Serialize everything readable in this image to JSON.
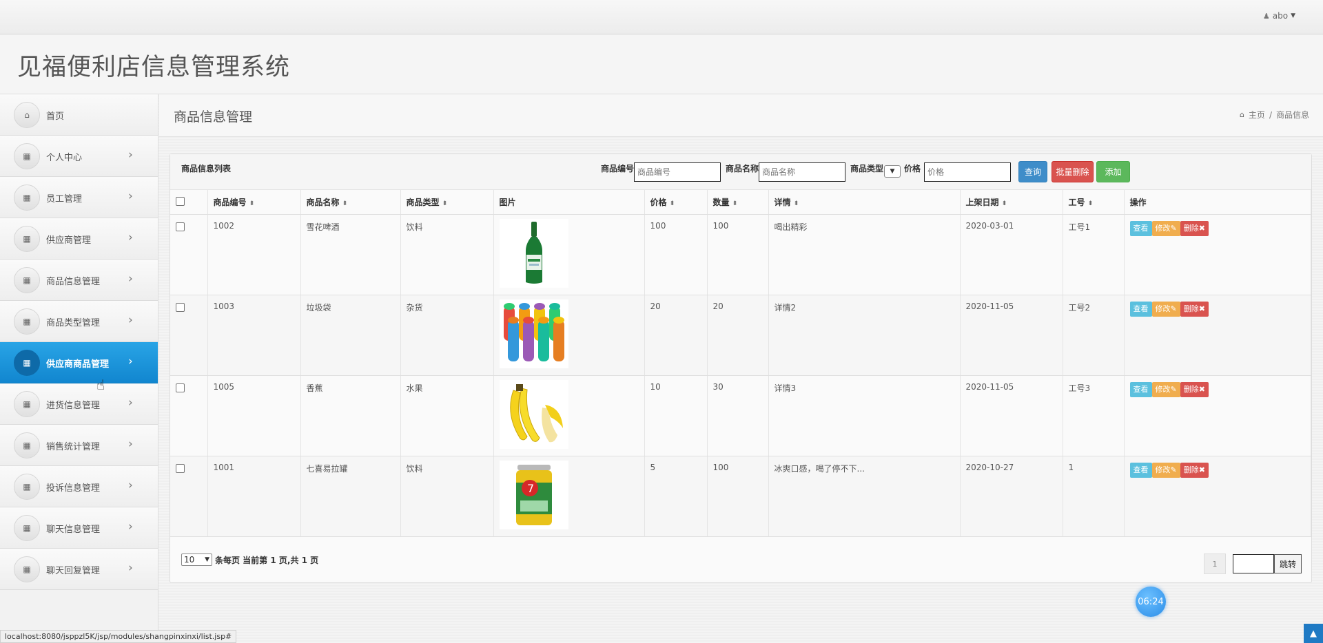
{
  "topbar": {
    "user_name": "abo"
  },
  "header": {
    "app_title": "见福便利店信息管理系统"
  },
  "sidebar": {
    "items": [
      {
        "label": "首页",
        "icon": "home-icon",
        "chevron": false,
        "active": false
      },
      {
        "label": "个人中心",
        "icon": "grid-icon",
        "chevron": true,
        "active": false
      },
      {
        "label": "员工管理",
        "icon": "grid-icon",
        "chevron": true,
        "active": false
      },
      {
        "label": "供应商管理",
        "icon": "grid-icon",
        "chevron": true,
        "active": false
      },
      {
        "label": "商品信息管理",
        "icon": "grid-icon",
        "chevron": true,
        "active": false
      },
      {
        "label": "商品类型管理",
        "icon": "grid-icon",
        "chevron": true,
        "active": false
      },
      {
        "label": "供应商商品管理",
        "icon": "grid-icon",
        "chevron": true,
        "active": true
      },
      {
        "label": "进货信息管理",
        "icon": "grid-icon",
        "chevron": true,
        "active": false
      },
      {
        "label": "销售统计管理",
        "icon": "grid-icon",
        "chevron": true,
        "active": false
      },
      {
        "label": "投诉信息管理",
        "icon": "grid-icon",
        "chevron": true,
        "active": false
      },
      {
        "label": "聊天信息管理",
        "icon": "grid-icon",
        "chevron": true,
        "active": false
      },
      {
        "label": "聊天回复管理",
        "icon": "grid-icon",
        "chevron": true,
        "active": false
      }
    ]
  },
  "content": {
    "title": "商品信息管理",
    "breadcrumb": {
      "home": "主页",
      "separator": "/",
      "current": "商品信息"
    }
  },
  "panel": {
    "title": "商品信息列表",
    "filters": {
      "code_label": "商品编号",
      "code_placeholder": "商品编号",
      "name_label": "商品名称",
      "name_placeholder": "商品名称",
      "type_label": "商品类型",
      "price_label": "价格",
      "price_placeholder": "价格"
    },
    "buttons": {
      "search": "查询",
      "batch_delete": "批量删除",
      "add": "添加"
    }
  },
  "table": {
    "columns": [
      "商品编号",
      "商品名称",
      "商品类型",
      "图片",
      "价格",
      "数量",
      "详情",
      "上架日期",
      "工号",
      "操作"
    ],
    "action_labels": {
      "view": "查看",
      "edit": "修改",
      "delete": "删除"
    },
    "rows": [
      {
        "code": "1002",
        "name": "雪花啤酒",
        "type": "饮料",
        "image": "beer-bottle",
        "price": "100",
        "qty": "100",
        "detail": "喝出精彩",
        "date": "2020-03-01",
        "staff": "工号1"
      },
      {
        "code": "1003",
        "name": "垃圾袋",
        "type": "杂货",
        "image": "trash-bag-rolls",
        "price": "20",
        "qty": "20",
        "detail": "详情2",
        "date": "2020-11-05",
        "staff": "工号2"
      },
      {
        "code": "1005",
        "name": "香蕉",
        "type": "水果",
        "image": "bananas",
        "price": "10",
        "qty": "30",
        "detail": "详情3",
        "date": "2020-11-05",
        "staff": "工号3"
      },
      {
        "code": "1001",
        "name": "七喜易拉罐",
        "type": "饮料",
        "image": "7up-can",
        "price": "5",
        "qty": "100",
        "detail": "冰爽口感，喝了停不下...",
        "date": "2020-10-27",
        "staff": "1"
      }
    ]
  },
  "pager": {
    "page_size": "10",
    "summary": "条每页 当前第 1 页,共 1 页",
    "current_page": "1",
    "jump_label": "跳转"
  },
  "clock": "06:24",
  "status_url": "localhost:8080/jsppzl5K/jsp/modules/shangpinxinxi/list.jsp#",
  "colors": {
    "active_nav": "#1a8fd6",
    "btn_search": "#3e8dc9",
    "btn_delete": "#d9534f",
    "btn_add": "#5cb85c",
    "act_view": "#5bc0de",
    "act_edit": "#f0ad4e",
    "act_delete": "#d9534f"
  }
}
